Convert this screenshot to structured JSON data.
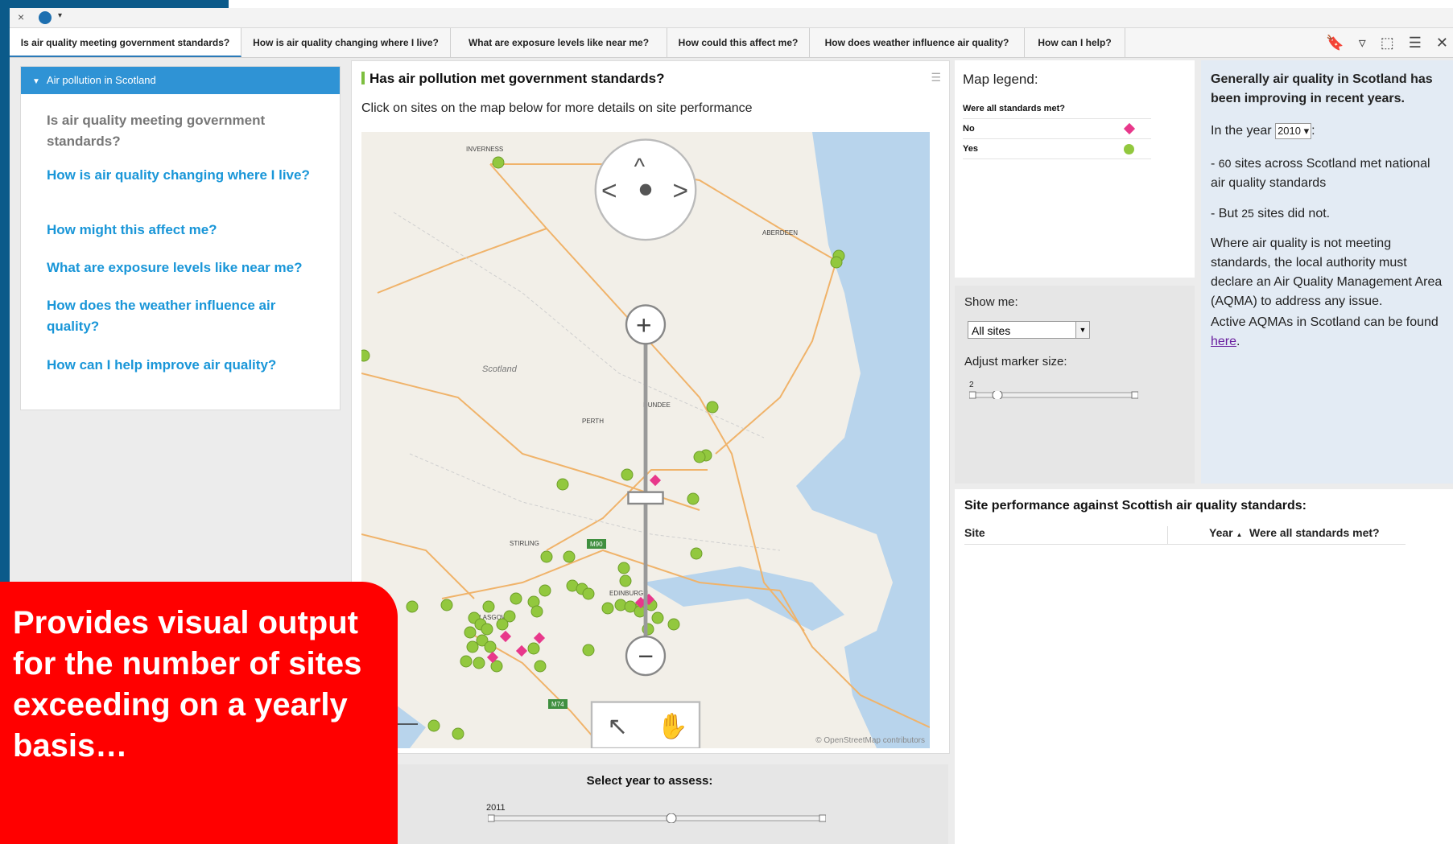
{
  "toolbar": {
    "close": "×",
    "menu_caret": "▾"
  },
  "tabs": [
    {
      "label": "Is air quality meeting government standards?"
    },
    {
      "label": "How is air quality changing where I live?"
    },
    {
      "label": "What are exposure levels like near me?"
    },
    {
      "label": "How could this affect me?"
    },
    {
      "label": "How does weather influence air quality?"
    },
    {
      "label": "How can I help?"
    }
  ],
  "tab_icons": [
    "bookmark-icon",
    "filter-icon",
    "selection-icon",
    "menu-icon",
    "close-icon"
  ],
  "nav": {
    "header": "Air pollution in Scotland",
    "items": [
      {
        "label": "Is air quality meeting government standards?"
      },
      {
        "label": "How is air quality changing where I live?"
      },
      {
        "label": "How might this affect me?"
      },
      {
        "label": "What are exposure levels like near me?"
      },
      {
        "label": "How does the weather influence air quality?"
      },
      {
        "label": "How can I help improve air quality?"
      }
    ]
  },
  "map": {
    "title": "Has air pollution met government standards?",
    "subtitle": "Click on sites on the map below for more details on site performance",
    "attribution": "© OpenStreetMap contributors",
    "places": {
      "inverness": "INVERNESS",
      "aberdeen": "ABERDEEN",
      "scotland": "Scotland",
      "dundee": "DUNDEE",
      "perth": "PERTH",
      "stirling": "STIRLING",
      "edinburgh": "EDINBURGH",
      "glasgow": "GLASGOW",
      "m90": "M90",
      "m74": "M74"
    },
    "colors": {
      "no": "#e8388b",
      "yes": "#92c83e"
    }
  },
  "legend": {
    "title": "Map legend:",
    "header": "Were all standards met?",
    "rows": [
      {
        "label": "No"
      },
      {
        "label": "Yes"
      }
    ]
  },
  "controls": {
    "show_label": "Show me:",
    "show_value": "All sites",
    "marker_label": "Adjust marker size:",
    "marker_value": "2"
  },
  "info": {
    "heading": "Generally air quality in Scotland has been improving in recent years.",
    "year_prefix": "In the year",
    "year": "2010",
    "year_suffix": ":",
    "met_count": "60",
    "met_text": "sites across Scotland met national air quality standards",
    "not_met_count": "25",
    "not_met_prefix": "- But",
    "not_met_suffix": "sites did not.",
    "aqma_text": "Where air quality is not meeting standards, the local authority must declare an Air Quality Management Area (AQMA) to address any issue.",
    "active_text": "Active AQMAs in Scotland can be found",
    "link": "here",
    "period": "."
  },
  "table": {
    "title": "Site performance against Scottish air quality standards:",
    "columns": [
      "Site",
      "Year",
      "Were all standards met?"
    ],
    "sort_indicator": "▲"
  },
  "year_selector": {
    "label": "Select year to assess:",
    "value": "2011"
  },
  "callout": {
    "text": "Provides visual output for the number of sites exceeding on a yearly basis…"
  }
}
